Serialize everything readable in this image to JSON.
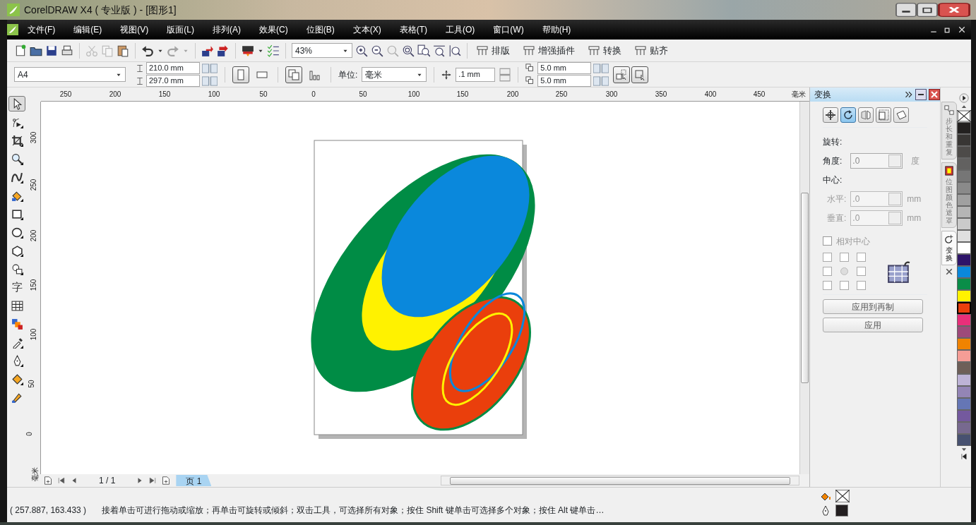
{
  "window": {
    "title": "CorelDRAW X4 ( 专业版 ) - [图形1]"
  },
  "menu": [
    {
      "label": "文件(F)"
    },
    {
      "label": "编辑(E)"
    },
    {
      "label": "视图(V)"
    },
    {
      "label": "版面(L)"
    },
    {
      "label": "排列(A)"
    },
    {
      "label": "效果(C)"
    },
    {
      "label": "位图(B)"
    },
    {
      "label": "文本(X)"
    },
    {
      "label": "表格(T)"
    },
    {
      "label": "工具(O)"
    },
    {
      "label": "窗口(W)"
    },
    {
      "label": "帮助(H)"
    }
  ],
  "toolbar": {
    "buttons": [
      {
        "kind": "new",
        "disabled": false
      },
      {
        "kind": "open",
        "disabled": false
      },
      {
        "kind": "save",
        "disabled": false
      },
      {
        "kind": "print",
        "disabled": false
      },
      {
        "kind": "sep"
      },
      {
        "kind": "cut",
        "disabled": true
      },
      {
        "kind": "copy",
        "disabled": true
      },
      {
        "kind": "paste",
        "disabled": false
      },
      {
        "kind": "sep"
      },
      {
        "kind": "undo",
        "disabled": false
      },
      {
        "kind": "caret",
        "disabled": false
      },
      {
        "kind": "redo",
        "disabled": true
      },
      {
        "kind": "caret",
        "disabled": true
      },
      {
        "kind": "sep"
      },
      {
        "kind": "import",
        "disabled": false
      },
      {
        "kind": "export",
        "disabled": false
      },
      {
        "kind": "sep"
      },
      {
        "kind": "publish",
        "disabled": false
      },
      {
        "kind": "caret",
        "disabled": false
      },
      {
        "kind": "options",
        "disabled": false
      }
    ],
    "zoom": "43%",
    "zoom_buttons": [
      {
        "kind": "zoom-in"
      },
      {
        "kind": "zoom-out"
      },
      {
        "kind": "zoom-selected"
      },
      {
        "kind": "zoom-all"
      },
      {
        "kind": "zoom-page"
      },
      {
        "kind": "zoom-width"
      },
      {
        "kind": "zoom-height"
      }
    ],
    "toolbars": [
      {
        "label": "排版"
      },
      {
        "label": "增强插件"
      },
      {
        "label": "转换"
      },
      {
        "label": "贴齐"
      }
    ]
  },
  "property_bar": {
    "paper": "A4",
    "width": "210.0 mm",
    "height": "297.0 mm",
    "orientation": [
      {
        "kind": "portrait",
        "selected": true
      },
      {
        "kind": "landscape",
        "selected": false
      }
    ],
    "layout": [
      {
        "kind": "all-pages",
        "selected": true
      },
      {
        "kind": "current-page",
        "selected": false
      }
    ],
    "unit_label": "单位:",
    "unit": "毫米",
    "nudge": ".1 mm",
    "duplicate_x": "5.0 mm",
    "duplicate_y": "5.0 mm",
    "toggles": [
      {
        "kind": "treat-as-filled",
        "selected": true
      },
      {
        "kind": "bounding-box",
        "selected": true
      }
    ]
  },
  "toolbox": [
    {
      "kind": "pick",
      "selected": true
    },
    {
      "kind": "shape",
      "selected": false
    },
    {
      "kind": "crop",
      "selected": false
    },
    {
      "kind": "zoom",
      "selected": false
    },
    {
      "kind": "freehand",
      "selected": false
    },
    {
      "kind": "smart-fill",
      "selected": false
    },
    {
      "kind": "rectangle",
      "selected": false
    },
    {
      "kind": "ellipse",
      "selected": false
    },
    {
      "kind": "polygon",
      "selected": false
    },
    {
      "kind": "basic-shapes",
      "selected": false
    },
    {
      "kind": "text",
      "glyph": "字",
      "selected": false
    },
    {
      "kind": "table",
      "selected": false
    },
    {
      "kind": "blend",
      "selected": false
    },
    {
      "kind": "eyedropper",
      "selected": false
    },
    {
      "kind": "outline",
      "selected": false
    },
    {
      "kind": "fill",
      "selected": false
    },
    {
      "kind": "interactive-fill",
      "selected": false
    }
  ],
  "rulers": {
    "horizontal": [
      "250",
      "200",
      "150",
      "100",
      "50",
      "0",
      "50",
      "100",
      "150",
      "200",
      "250",
      "300",
      "350",
      "400",
      "450",
      "毫米"
    ],
    "vertical": [
      "300",
      "250",
      "200",
      "150",
      "100",
      "50",
      "0",
      "毫米"
    ]
  },
  "page_nav": {
    "counter": "1 / 1",
    "tabs": [
      {
        "label": "页 1",
        "selected": true
      }
    ]
  },
  "docker": {
    "title": "变换",
    "modes": [
      {
        "kind": "position",
        "selected": false
      },
      {
        "kind": "rotate",
        "selected": true
      },
      {
        "kind": "scale",
        "selected": false
      },
      {
        "kind": "size",
        "selected": false
      },
      {
        "kind": "skew",
        "selected": false
      }
    ],
    "section": "旋转:",
    "angle": {
      "label": "角度:",
      "value": ".0",
      "unit": "度"
    },
    "center_label": "中心:",
    "center": [
      {
        "label": "水平:",
        "value": ".0",
        "unit": "mm",
        "disabled": true
      },
      {
        "label": "垂直:",
        "value": ".0",
        "unit": "mm",
        "disabled": true
      }
    ],
    "relative_center": {
      "label": "相对中心",
      "checked": false
    },
    "buttons": [
      {
        "label": "应用到再制"
      },
      {
        "label": "应用"
      }
    ]
  },
  "docker_tabs": [
    {
      "label": "步长和重复",
      "kind": "step",
      "selected": false
    },
    {
      "label": "位图颜色遮罩",
      "kind": "mask",
      "selected": false
    },
    {
      "label": "变换",
      "kind": "transform",
      "selected": true
    }
  ],
  "palette": [
    {
      "kind": "none",
      "selected": false
    },
    {
      "color": "#232120",
      "selected": false
    },
    {
      "color": "#383634",
      "selected": false
    },
    {
      "color": "#4d4b49",
      "selected": false
    },
    {
      "color": "#626160",
      "selected": false
    },
    {
      "color": "#767676",
      "selected": false
    },
    {
      "color": "#8a8a8a",
      "selected": false
    },
    {
      "color": "#a0a0a0",
      "selected": false
    },
    {
      "color": "#b5b5b5",
      "selected": false
    },
    {
      "color": "#cacaca",
      "selected": false
    },
    {
      "color": "#dfdfdf",
      "selected": false
    },
    {
      "color": "#ffffff",
      "selected": false
    },
    {
      "color": "#2e1469",
      "selected": false
    },
    {
      "color": "#0a88dc",
      "selected": false
    },
    {
      "color": "#0a8d48",
      "selected": false
    },
    {
      "color": "#fff200",
      "selected": false
    },
    {
      "color": "#ea3f0c",
      "selected": true
    },
    {
      "color": "#e92f7a",
      "selected": false
    },
    {
      "color": "#9e4a7a",
      "selected": false
    },
    {
      "color": "#f08300",
      "selected": false
    },
    {
      "color": "#f59d96",
      "selected": false
    },
    {
      "color": "#6e5f58",
      "selected": false
    },
    {
      "color": "#bdb3d6",
      "selected": false
    },
    {
      "color": "#9385b5",
      "selected": false
    },
    {
      "color": "#6576b5",
      "selected": false
    },
    {
      "color": "#74599e",
      "selected": false
    },
    {
      "color": "#77698f",
      "selected": false
    },
    {
      "color": "#475170",
      "selected": false
    }
  ],
  "status_bar": {
    "coordinates": "( 257.887, 163.433 )",
    "message": "接着单击可进行拖动或缩放；再单击可旋转或倾斜；双击工具，可选择所有对象；按住 Shift 键单击可选择多个对象；按住 Alt 键单击…",
    "fill": {
      "kind": "none"
    },
    "outline": {
      "color": "#231f20"
    }
  }
}
